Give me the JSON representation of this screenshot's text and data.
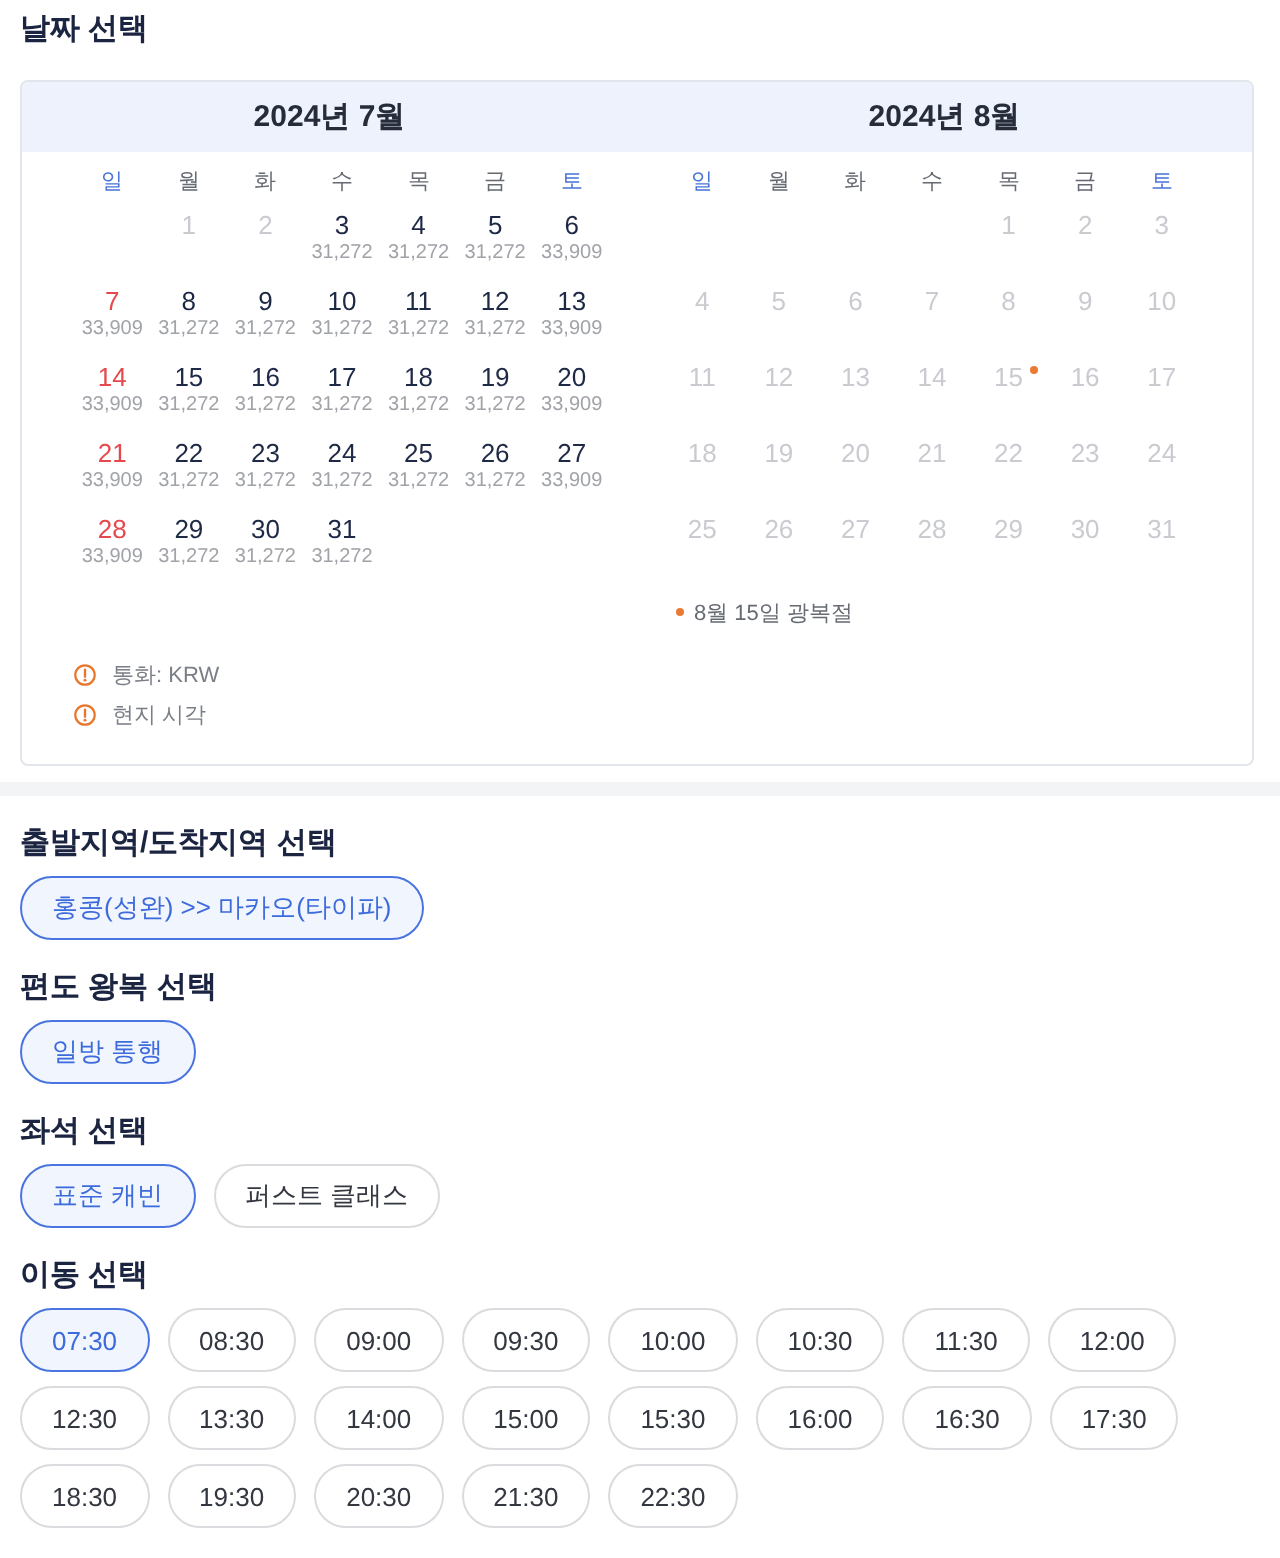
{
  "date_picker": {
    "title": "날짜 선택",
    "months": [
      {
        "title": "2024년 7월",
        "weekdays": [
          {
            "label": "일",
            "kind": "weekend"
          },
          {
            "label": "월",
            "kind": "weekday"
          },
          {
            "label": "화",
            "kind": "weekday"
          },
          {
            "label": "수",
            "kind": "weekday"
          },
          {
            "label": "목",
            "kind": "weekday"
          },
          {
            "label": "금",
            "kind": "weekday"
          },
          {
            "label": "토",
            "kind": "weekend"
          }
        ],
        "weeks": [
          [
            {
              "day": "1",
              "disabled": true,
              "marked": false
            },
            {
              "day": "2",
              "disabled": true,
              "marked": false
            },
            {
              "day": "3",
              "price": "31,272",
              "disabled": false,
              "marked": false
            },
            {
              "day": "4",
              "price": "31,272",
              "disabled": false,
              "marked": false
            },
            {
              "day": "5",
              "price": "31,272",
              "disabled": false,
              "marked": false
            },
            {
              "day": "6",
              "price": "33,909",
              "disabled": false,
              "marked": false
            }
          ],
          [
            {
              "day": "7",
              "price": "33,909",
              "disabled": false,
              "marked": false
            },
            {
              "day": "8",
              "price": "31,272",
              "disabled": false,
              "marked": false
            },
            {
              "day": "9",
              "price": "31,272",
              "disabled": false,
              "marked": false
            },
            {
              "day": "10",
              "price": "31,272",
              "disabled": false,
              "marked": false
            },
            {
              "day": "11",
              "price": "31,272",
              "disabled": false,
              "marked": false
            },
            {
              "day": "12",
              "price": "31,272",
              "disabled": false,
              "marked": false
            },
            {
              "day": "13",
              "price": "33,909",
              "disabled": false,
              "marked": false
            }
          ],
          [
            {
              "day": "14",
              "price": "33,909",
              "disabled": false,
              "marked": false
            },
            {
              "day": "15",
              "price": "31,272",
              "disabled": false,
              "marked": false
            },
            {
              "day": "16",
              "price": "31,272",
              "disabled": false,
              "marked": false
            },
            {
              "day": "17",
              "price": "31,272",
              "disabled": false,
              "marked": false
            },
            {
              "day": "18",
              "price": "31,272",
              "disabled": false,
              "marked": false
            },
            {
              "day": "19",
              "price": "31,272",
              "disabled": false,
              "marked": false
            },
            {
              "day": "20",
              "price": "33,909",
              "disabled": false,
              "marked": false
            }
          ],
          [
            {
              "day": "21",
              "price": "33,909",
              "disabled": false,
              "marked": false
            },
            {
              "day": "22",
              "price": "31,272",
              "disabled": false,
              "marked": false
            },
            {
              "day": "23",
              "price": "31,272",
              "disabled": false,
              "marked": false
            },
            {
              "day": "24",
              "price": "31,272",
              "disabled": false,
              "marked": false
            },
            {
              "day": "25",
              "price": "31,272",
              "disabled": false,
              "marked": false
            },
            {
              "day": "26",
              "price": "31,272",
              "disabled": false,
              "marked": false
            },
            {
              "day": "27",
              "price": "33,909",
              "disabled": false,
              "marked": false
            }
          ],
          [
            {
              "day": "28",
              "price": "33,909",
              "disabled": false,
              "marked": false
            },
            {
              "day": "29",
              "price": "31,272",
              "disabled": false,
              "marked": false
            },
            {
              "day": "30",
              "price": "31,272",
              "disabled": false,
              "marked": false
            },
            {
              "day": "31",
              "price": "31,272",
              "disabled": false,
              "marked": false
            }
          ]
        ]
      },
      {
        "title": "2024년 8월",
        "weekdays": [
          {
            "label": "일",
            "kind": "weekend"
          },
          {
            "label": "월",
            "kind": "weekday"
          },
          {
            "label": "화",
            "kind": "weekday"
          },
          {
            "label": "수",
            "kind": "weekday"
          },
          {
            "label": "목",
            "kind": "weekday"
          },
          {
            "label": "금",
            "kind": "weekday"
          },
          {
            "label": "토",
            "kind": "weekend"
          }
        ],
        "weeks": [
          [
            {
              "day": "1",
              "disabled": true,
              "marked": false
            },
            {
              "day": "2",
              "disabled": true,
              "marked": false
            },
            {
              "day": "3",
              "disabled": true,
              "marked": false
            }
          ],
          [
            {
              "day": "4",
              "disabled": true,
              "marked": false
            },
            {
              "day": "5",
              "disabled": true,
              "marked": false
            },
            {
              "day": "6",
              "disabled": true,
              "marked": false
            },
            {
              "day": "7",
              "disabled": true,
              "marked": false
            },
            {
              "day": "8",
              "disabled": true,
              "marked": false
            },
            {
              "day": "9",
              "disabled": true,
              "marked": false
            },
            {
              "day": "10",
              "disabled": true,
              "marked": false
            }
          ],
          [
            {
              "day": "11",
              "disabled": true,
              "marked": false
            },
            {
              "day": "12",
              "disabled": true,
              "marked": false
            },
            {
              "day": "13",
              "disabled": true,
              "marked": false
            },
            {
              "day": "14",
              "disabled": true,
              "marked": false
            },
            {
              "day": "15",
              "disabled": true,
              "marked": true
            },
            {
              "day": "16",
              "disabled": true,
              "marked": false
            },
            {
              "day": "17",
              "disabled": true,
              "marked": false
            }
          ],
          [
            {
              "day": "18",
              "disabled": true,
              "marked": false
            },
            {
              "day": "19",
              "disabled": true,
              "marked": false
            },
            {
              "day": "20",
              "disabled": true,
              "marked": false
            },
            {
              "day": "21",
              "disabled": true,
              "marked": false
            },
            {
              "day": "22",
              "disabled": true,
              "marked": false
            },
            {
              "day": "23",
              "disabled": true,
              "marked": false
            },
            {
              "day": "24",
              "disabled": true,
              "marked": false
            }
          ],
          [
            {
              "day": "25",
              "disabled": true,
              "marked": false
            },
            {
              "day": "26",
              "disabled": true,
              "marked": false
            },
            {
              "day": "27",
              "disabled": true,
              "marked": false
            },
            {
              "day": "28",
              "disabled": true,
              "marked": false
            },
            {
              "day": "29",
              "disabled": true,
              "marked": false
            },
            {
              "day": "30",
              "disabled": true,
              "marked": false
            },
            {
              "day": "31",
              "disabled": true,
              "marked": false
            }
          ]
        ],
        "note": "8월 15일 광복절"
      }
    ],
    "notes": [
      "통화: KRW",
      "현지 시각"
    ]
  },
  "sections": [
    {
      "title": "출발지역/도착지역 선택",
      "options": [
        {
          "label": "홍콩(성완) >> 마카오(타이파)",
          "selected": true
        }
      ]
    },
    {
      "title": "편도 왕복 선택",
      "options": [
        {
          "label": "일방 통행",
          "selected": true
        }
      ]
    },
    {
      "title": "좌석 선택",
      "options": [
        {
          "label": "표준 캐빈",
          "selected": true
        },
        {
          "label": "퍼스트 클래스",
          "selected": false
        }
      ]
    },
    {
      "title": "이동 선택",
      "options": [
        {
          "label": "07:30",
          "selected": true
        },
        {
          "label": "08:30",
          "selected": false
        },
        {
          "label": "09:00",
          "selected": false
        },
        {
          "label": "09:30",
          "selected": false
        },
        {
          "label": "10:00",
          "selected": false
        },
        {
          "label": "10:30",
          "selected": false
        },
        {
          "label": "11:30",
          "selected": false
        },
        {
          "label": "12:00",
          "selected": false
        },
        {
          "label": "12:30",
          "selected": false
        },
        {
          "label": "13:30",
          "selected": false
        },
        {
          "label": "14:00",
          "selected": false
        },
        {
          "label": "15:00",
          "selected": false
        },
        {
          "label": "15:30",
          "selected": false
        },
        {
          "label": "16:00",
          "selected": false
        },
        {
          "label": "16:30",
          "selected": false
        },
        {
          "label": "17:30",
          "selected": false
        },
        {
          "label": "18:30",
          "selected": false
        },
        {
          "label": "19:30",
          "selected": false
        },
        {
          "label": "20:30",
          "selected": false
        },
        {
          "label": "21:30",
          "selected": false
        },
        {
          "label": "22:30",
          "selected": false
        }
      ]
    }
  ]
}
